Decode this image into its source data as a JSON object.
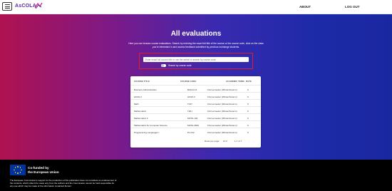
{
  "nav": {
    "logo_text": "AsCOLA",
    "about": "ABOUT",
    "logout": "LOG OUT"
  },
  "hero": {
    "title": "All evaluations",
    "description": "Here you can browse course evaluations. Search by entering the exact full title of the course or the course code, click on the class you're interested in and access feedback submitted by previous exchange students.",
    "search_placeholder": "Enter exact full course title or use the switch to search by course code",
    "toggle_label": "Search by course code"
  },
  "table": {
    "headers": [
      "COURSE TITLE",
      "COURSE CODE",
      "ACADEMIC TERM",
      "RATE"
    ],
    "rows": [
      [
        "Business Administration",
        "BA101-F1",
        "First semester (Winter/Autumn)",
        "6"
      ],
      [
        "HCML II",
        "HCML II",
        "First semester (Winter/Autumn)",
        "6"
      ],
      [
        "Math",
        "T167",
        "First semester (Winter/Autumn)",
        "6"
      ],
      [
        "Mathematics",
        "T2IH",
        "First semester (Winter/Autumn)",
        "6"
      ],
      [
        "Mathematics II",
        "MATH-192",
        "First semester (Winter/Autumn)",
        "6"
      ],
      [
        "Mathematics for Computer Science",
        "MATH-3819",
        "First semester (Winter/Autumn)",
        "6"
      ],
      [
        "Programming Languages I",
        "PL-012",
        "First semester (Winter/Autumn)",
        "6"
      ]
    ],
    "rows_per_page_label": "Rows per page:",
    "rows_per_page_value": "10",
    "pagination_text": "1-7 of 7"
  },
  "footer": {
    "cofunded_line1": "Co-funded by",
    "cofunded_line2": "the European Union",
    "disclaimer": "The European Commission's support for the production of this publication does not constitute an endorsement of the contents, which reflect the views only from the authors and the Commission cannot be held responsible for any use which may be made of the information contained therein."
  },
  "colors": {
    "accent": "#e02020",
    "brand": "#5a2aa0",
    "eu_blue": "#0033a0",
    "eu_yellow": "#ffcc00"
  }
}
